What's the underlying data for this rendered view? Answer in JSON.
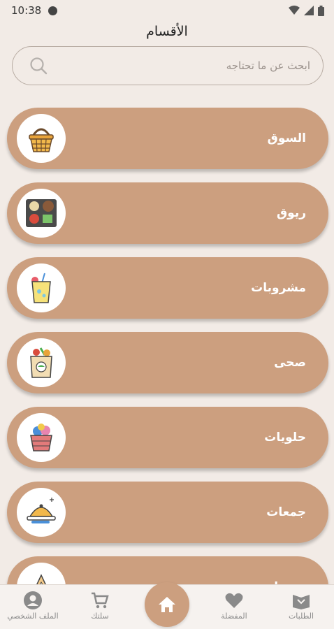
{
  "status_bar": {
    "time": "10:38"
  },
  "header": {
    "title": "الأقسام"
  },
  "search": {
    "placeholder": "ابحث عن ما تحتاجه"
  },
  "categories": [
    {
      "label": "السوق",
      "icon": "basket-icon"
    },
    {
      "label": "ريوق",
      "icon": "breakfast-tray-icon"
    },
    {
      "label": "مشروبات",
      "icon": "juice-icon"
    },
    {
      "label": "صحى",
      "icon": "grocery-bag-icon"
    },
    {
      "label": "حلويات",
      "icon": "ice-cream-basket-icon"
    },
    {
      "label": "جمعات",
      "icon": "serving-dish-icon"
    },
    {
      "label": "معجنات",
      "icon": "pastry-icon"
    }
  ],
  "bottom_nav": {
    "profile": "الملف الشخصي",
    "cart": "سلتك",
    "favorites": "المفضلة",
    "orders": "الطلبات"
  },
  "colors": {
    "accent": "#cc9f7f",
    "background": "#f2ebe6"
  }
}
